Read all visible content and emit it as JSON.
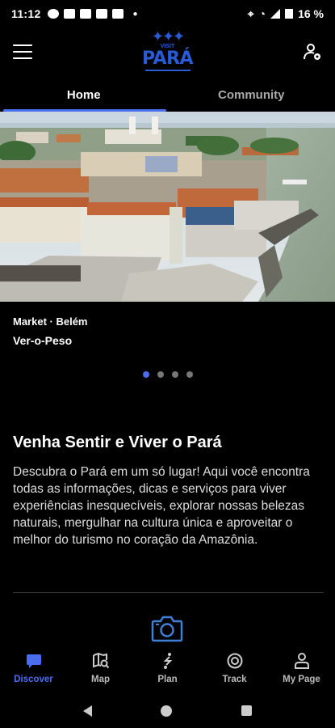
{
  "status_bar": {
    "time": "11:12",
    "battery": "16 %"
  },
  "header": {
    "logo_small": "VISIT",
    "logo_main": "PARÁ",
    "menu_icon": "hamburger-menu-icon",
    "profile_icon": "user-settings-icon"
  },
  "tabs": [
    {
      "label": "Home",
      "active": true
    },
    {
      "label": "Community",
      "active": false
    }
  ],
  "carousel": {
    "subtitle": "Market · Belém",
    "title": "Ver-o-Peso",
    "dot_count": 4,
    "active_index": 0
  },
  "intro": {
    "title": "Venha Sentir e Viver o Pará",
    "text": "Descubra o Pará em um só lugar! Aqui você encontra todas as informações, dicas e serviços para viver experiências inesquecíveis, explorar nossas belezas naturais, mergulhar na cultura única e aproveitar o melhor do turismo no coração da Amazônia."
  },
  "bottom_nav": [
    {
      "label": "Discover",
      "icon": "chat-bubble-icon",
      "active": true
    },
    {
      "label": "Map",
      "icon": "map-search-icon",
      "active": false
    },
    {
      "label": "Plan",
      "icon": "route-icon",
      "active": false
    },
    {
      "label": "Track",
      "icon": "target-icon",
      "active": false
    },
    {
      "label": "My Page",
      "icon": "person-icon",
      "active": false
    }
  ],
  "colors": {
    "accent": "#4a6df0",
    "logo_blue": "#2a5bd7",
    "background": "#000000"
  }
}
